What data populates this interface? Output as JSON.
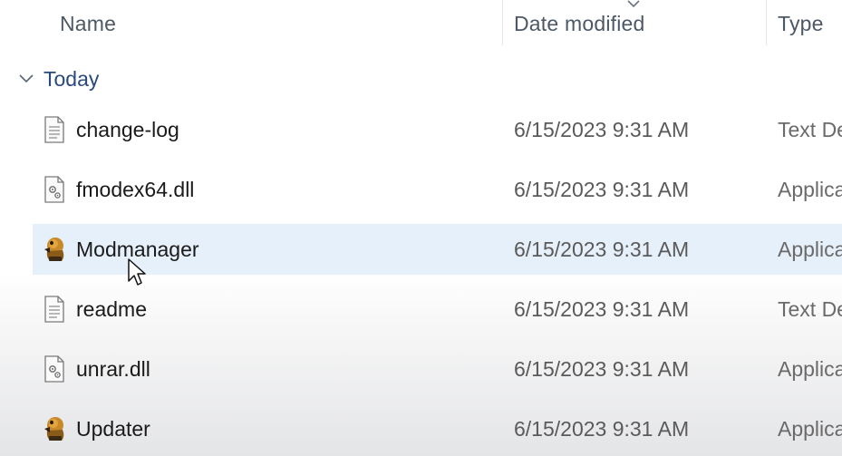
{
  "columns": {
    "name": "Name",
    "date_modified": "Date modified",
    "type": "Type"
  },
  "group": {
    "label": "Today",
    "state": "expanded"
  },
  "files": [
    {
      "name": "change-log",
      "date": "6/15/2023 9:31 AM",
      "type": "Text De",
      "icon": "text-file-icon",
      "selected": false
    },
    {
      "name": "fmodex64.dll",
      "date": "6/15/2023 9:31 AM",
      "type": "Applica",
      "icon": "dll-file-icon",
      "selected": false
    },
    {
      "name": "Modmanager",
      "date": "6/15/2023 9:31 AM",
      "type": "Applica",
      "icon": "app-icon",
      "selected": true
    },
    {
      "name": "readme",
      "date": "6/15/2023 9:31 AM",
      "type": "Text De",
      "icon": "text-file-icon",
      "selected": false
    },
    {
      "name": "unrar.dll",
      "date": "6/15/2023 9:31 AM",
      "type": "Applica",
      "icon": "dll-file-icon",
      "selected": false
    },
    {
      "name": "Updater",
      "date": "6/15/2023 9:31 AM",
      "type": "Applica",
      "icon": "app-icon",
      "selected": false
    }
  ],
  "colors": {
    "selection": "#e6f0fb",
    "header_text": "#4d5866",
    "group_text": "#2a4a7c"
  }
}
